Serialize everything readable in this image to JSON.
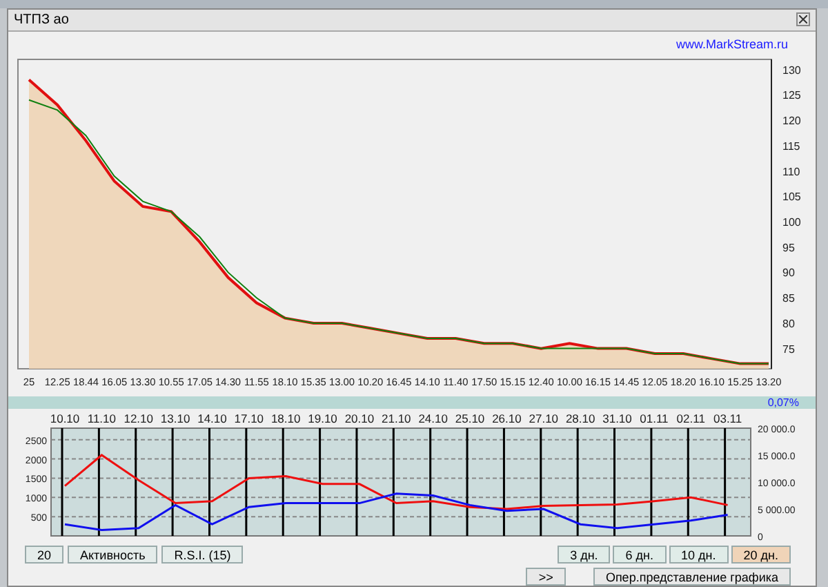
{
  "window": {
    "title": "ЧТПЗ ао"
  },
  "site_link": "www.MarkStream.ru",
  "price_chart": {
    "chart_data": {
      "type": "area",
      "categories": [
        "25",
        "12.25",
        "18.44",
        "16.05",
        "13.30",
        "10.55",
        "17.05",
        "14.30",
        "11.55",
        "18.10",
        "15.35",
        "13.00",
        "10.20",
        "16.45",
        "14.10",
        "11.40",
        "17.50",
        "15.15",
        "12.40",
        "10.00",
        "16.15",
        "14.45",
        "12.05",
        "18.20",
        "16.10",
        "15.25",
        "13.20"
      ],
      "ylim": [
        71,
        132
      ],
      "yticks": [
        75,
        80,
        85,
        90,
        95,
        100,
        105,
        110,
        115,
        120,
        125,
        130
      ],
      "series": [
        {
          "color": "#e01010",
          "values": [
            128,
            123,
            116,
            108,
            103,
            102,
            96,
            89,
            84,
            81,
            80,
            80,
            79,
            78,
            77,
            77,
            76,
            76,
            75,
            76,
            75,
            75,
            74,
            74,
            73,
            72,
            72
          ]
        },
        {
          "type": "line",
          "color": "#108010",
          "values": [
            124,
            122,
            117,
            109,
            104,
            102,
            97,
            90,
            85,
            81,
            80,
            80,
            79,
            78,
            77,
            77,
            76,
            76,
            75,
            75,
            75,
            75,
            74,
            74,
            73,
            72,
            72
          ]
        }
      ]
    }
  },
  "change": "0,07%",
  "activity_chart": {
    "right_axis_labels": [
      "20 000.0",
      "15 000.0",
      "10 000.0",
      "5 000.00",
      "0"
    ],
    "chart_data": {
      "type": "line",
      "grid": true,
      "categories": [
        "10.10",
        "11.10",
        "12.10",
        "13.10",
        "14.10",
        "17.10",
        "18.10",
        "19.10",
        "20.10",
        "21.10",
        "24.10",
        "25.10",
        "26.10",
        "27.10",
        "28.10",
        "31.10",
        "01.11",
        "02.11",
        "03.11"
      ],
      "ylim": [
        0,
        2800
      ],
      "yticks": [
        500,
        1000,
        1500,
        2000,
        2500
      ],
      "series": [
        {
          "color": "#ee1010",
          "values": [
            1300,
            2100,
            1450,
            850,
            900,
            1500,
            1550,
            1350,
            1350,
            850,
            900,
            750,
            700,
            780,
            800,
            820,
            900,
            1000,
            800
          ]
        },
        {
          "color": "#1010ee",
          "values": [
            300,
            150,
            200,
            800,
            300,
            750,
            850,
            850,
            850,
            1100,
            1050,
            800,
            650,
            700,
            300,
            200,
            300,
            400,
            550
          ]
        }
      ]
    }
  },
  "left_buttons": [
    {
      "label": "20"
    },
    {
      "label": "Активность"
    },
    {
      "label": "R.S.I. (15)"
    }
  ],
  "periods": [
    {
      "label": "3 дн.",
      "selected": false
    },
    {
      "label": "6 дн.",
      "selected": false
    },
    {
      "label": "10 дн.",
      "selected": false
    },
    {
      "label": "20 дн.",
      "selected": true
    }
  ],
  "next_button": ">>",
  "mode_button": "Опер.представление графика"
}
